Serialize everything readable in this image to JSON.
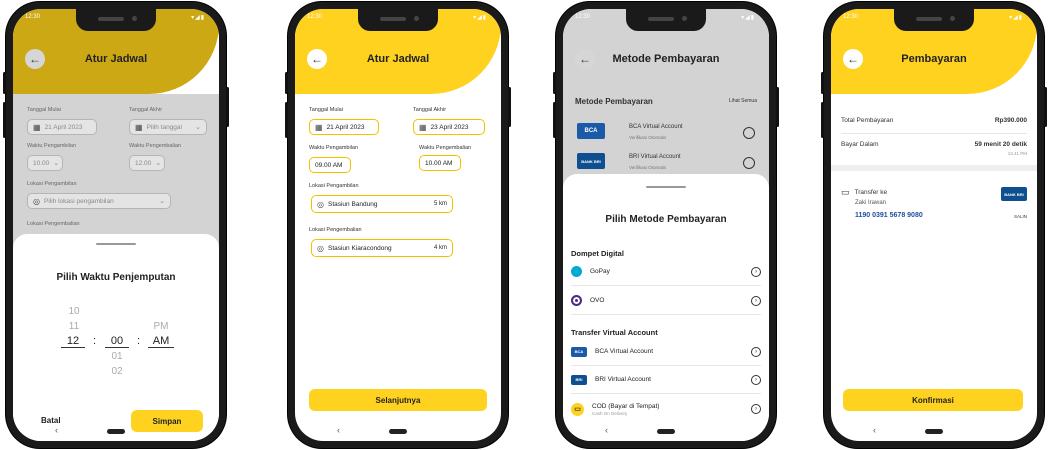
{
  "status": {
    "time": "12:30",
    "icons": "▾◢▮"
  },
  "screen1": {
    "title": "Atur Jadwal",
    "start_date_label": "Tanggal Mulai",
    "end_date_label": "Tanggal Akhir",
    "start_date_value": "21 April 2023",
    "end_date_placeholder": "Pilih tanggal",
    "pickup_time_label": "Waktu Pengambilan",
    "return_time_label": "Waktu Pengembalian",
    "pickup_time_value": "10.00",
    "return_time_value": "12.00",
    "pickup_location_label": "Lokasi Pengambilan",
    "pickup_location_placeholder": "Pilih lokasi pengambilan",
    "return_location_label": "Lokasi Pengembalian",
    "sheet_title": "Pilih Waktu Penjemputan",
    "hours_above": [
      "10",
      "11"
    ],
    "hour_selected": "12",
    "minute_selected": "00",
    "minutes_below": [
      "01",
      "02"
    ],
    "ampm_above": "PM",
    "ampm_selected": "AM",
    "cancel_label": "Batal",
    "save_label": "Simpan"
  },
  "screen2": {
    "title": "Atur Jadwal",
    "start_date_label": "Tanggal Mulai",
    "end_date_label": "Tanggal Akhir",
    "start_date_value": "21 April 2023",
    "end_date_value": "23 April 2023",
    "pickup_time_label": "Waktu Pengambilan",
    "return_time_label": "Waktu Pengembalian",
    "pickup_time_value": "09.00 AM",
    "return_time_value": "10.00 AM",
    "pickup_location_label": "Lokasi Pengambilan",
    "pickup_location_value": "Stasiun Bandung",
    "pickup_location_distance": "5 km",
    "return_location_label": "Lokasi Pengembalian",
    "return_location_value": "Stasiun Kiaracondong",
    "return_location_distance": "4 km",
    "next_label": "Selanjutnya"
  },
  "screen3": {
    "title": "Metode Pembayaran",
    "list_title": "Metode Pembayaran",
    "see_all": "Lihat Semua",
    "bg_items": [
      {
        "name": "BCA Virtual Account",
        "sub": "Verifikasi Otomatis",
        "logo": "BCA"
      },
      {
        "name": "BRI Virtual Account",
        "sub": "Verifikasi Otomatis",
        "logo": "BANK BRI"
      }
    ],
    "sheet_title": "Pilih Metode Pembayaran",
    "wallet_section": "Dompet Digital",
    "wallets": [
      {
        "name": "GoPay"
      },
      {
        "name": "OVO"
      }
    ],
    "va_section": "Transfer Virtual Account",
    "va_items": [
      {
        "name": "BCA Virtual Account",
        "logo": "BCA"
      },
      {
        "name": "BRI Virtual Account",
        "logo": "BRI"
      },
      {
        "name": "COD (Bayar di Tempat)",
        "sub": "Cash On Delivery"
      }
    ]
  },
  "screen4": {
    "title": "Pembayaran",
    "total_label": "Total Pembayaran",
    "total_value": "Rp390.000",
    "due_label": "Bayar Dalam",
    "due_value": "59 menit 20 detik",
    "due_time": "13.41 PM",
    "transfer_label": "Transfer ke",
    "account_name": "Zaki Irawan",
    "account_number": "1190 0391 5678 9080",
    "copy_label": "SALIN",
    "bank_logo": "BANK BRI",
    "confirm_label": "Konfirmasi"
  },
  "colors": {
    "accent": "#ffd21f",
    "bca": "#1a5aa8",
    "bri": "#0d4f8f",
    "ovo": "#4c2a86",
    "gopay": "#00aad2"
  }
}
